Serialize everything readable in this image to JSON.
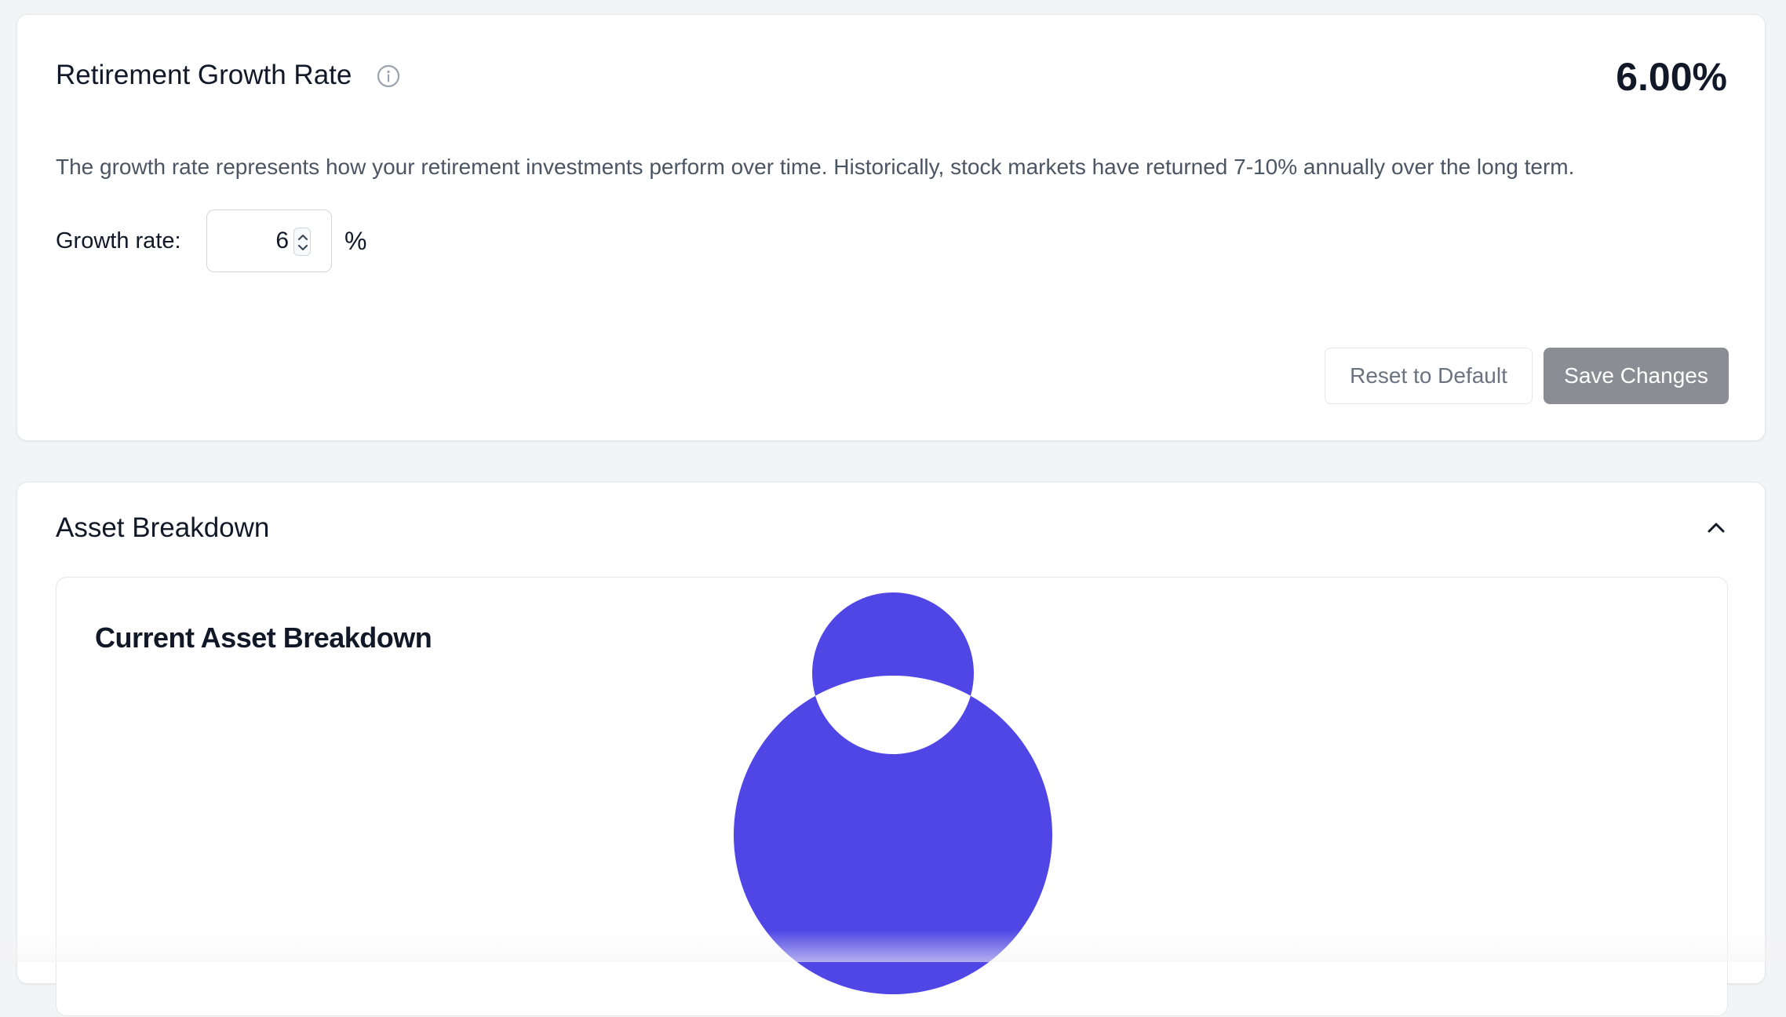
{
  "growth": {
    "title": "Retirement Growth Rate",
    "rate_display": "6.00%",
    "description": "The growth rate represents how your retirement investments perform over time. Historically, stock markets have returned 7-10% annually over the long term.",
    "input_label": "Growth rate:",
    "input_value": "6",
    "unit": "%",
    "reset_label": "Reset to Default",
    "save_label": "Save Changes"
  },
  "assets": {
    "title": "Asset Breakdown",
    "chart_title": "Current Asset Breakdown"
  },
  "chart_data": {
    "type": "pie",
    "title": "Current Asset Breakdown",
    "categories": [
      ""
    ],
    "values": [
      100
    ],
    "colors": [
      "#4f46e5"
    ]
  },
  "icons": {
    "info": "info-circle-icon",
    "collapse": "chevron-up-icon",
    "stepper": "up-down-stepper-icon"
  },
  "colors": {
    "accent": "#4f46e5",
    "save_button": "#8b8d94"
  }
}
